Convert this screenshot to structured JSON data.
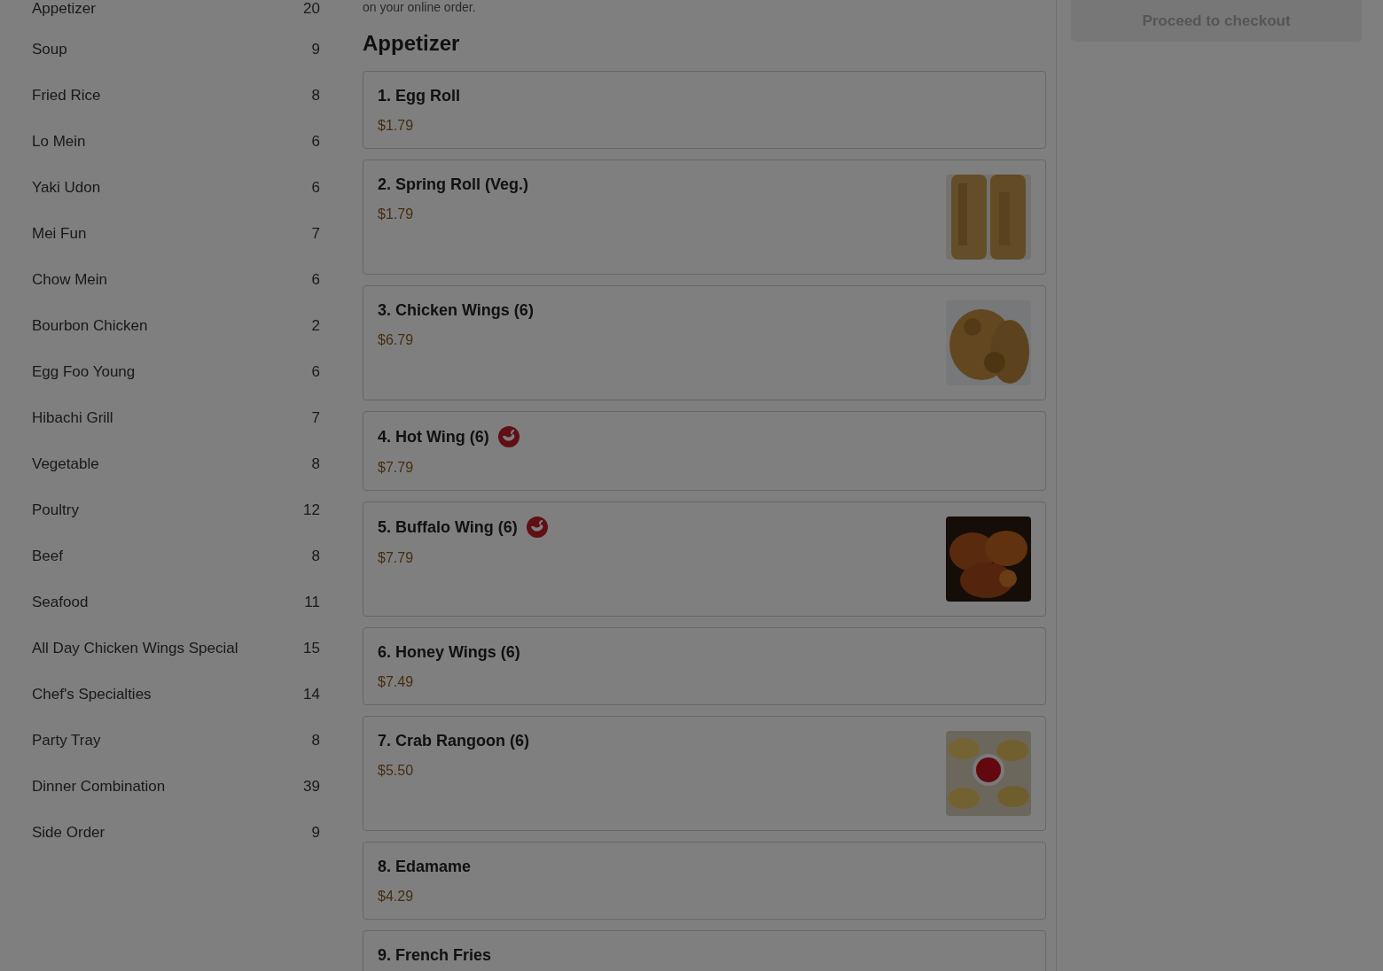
{
  "categories": [
    {
      "name": "Appetizer",
      "count": "20"
    },
    {
      "name": "Soup",
      "count": "9"
    },
    {
      "name": "Fried Rice",
      "count": "8"
    },
    {
      "name": "Lo Mein",
      "count": "6"
    },
    {
      "name": "Yaki Udon",
      "count": "6"
    },
    {
      "name": "Mei Fun",
      "count": "7"
    },
    {
      "name": "Chow Mein",
      "count": "6"
    },
    {
      "name": "Bourbon Chicken",
      "count": "2"
    },
    {
      "name": "Egg Foo Young",
      "count": "6"
    },
    {
      "name": "Hibachi Grill",
      "count": "7"
    },
    {
      "name": "Vegetable",
      "count": "8"
    },
    {
      "name": "Poultry",
      "count": "12"
    },
    {
      "name": "Beef",
      "count": "8"
    },
    {
      "name": "Seafood",
      "count": "11"
    },
    {
      "name": "All Day Chicken Wings Special",
      "count": "15"
    },
    {
      "name": "Chef's Specialties",
      "count": "14"
    },
    {
      "name": "Party Tray",
      "count": "8"
    },
    {
      "name": "Dinner Combination",
      "count": "39"
    },
    {
      "name": "Side Order",
      "count": "9"
    }
  ],
  "intro_text": "on your online order.",
  "section_title": "Appetizer",
  "items": [
    {
      "name": "1. Egg Roll",
      "price": "$1.79",
      "spicy": false,
      "photo": false
    },
    {
      "name": "2. Spring Roll (Veg.)",
      "price": "$1.79",
      "spicy": false,
      "photo": true
    },
    {
      "name": "3. Chicken Wings (6)",
      "price": "$6.79",
      "spicy": false,
      "photo": true
    },
    {
      "name": "4. Hot Wing (6)",
      "price": "$7.79",
      "spicy": true,
      "photo": false
    },
    {
      "name": "5. Buffalo Wing (6)",
      "price": "$7.79",
      "spicy": true,
      "photo": true
    },
    {
      "name": "6. Honey Wings (6)",
      "price": "$7.49",
      "spicy": false,
      "photo": false
    },
    {
      "name": "7. Crab Rangoon (6)",
      "price": "$5.50",
      "spicy": false,
      "photo": true
    },
    {
      "name": "8. Edamame",
      "price": "$4.29",
      "spicy": false,
      "photo": false
    },
    {
      "name": "9. French Fries",
      "spicy": false,
      "photo": false
    }
  ],
  "checkout_button": {
    "label": "Proceed to checkout",
    "disabled": true
  },
  "modal_backdrop": true
}
